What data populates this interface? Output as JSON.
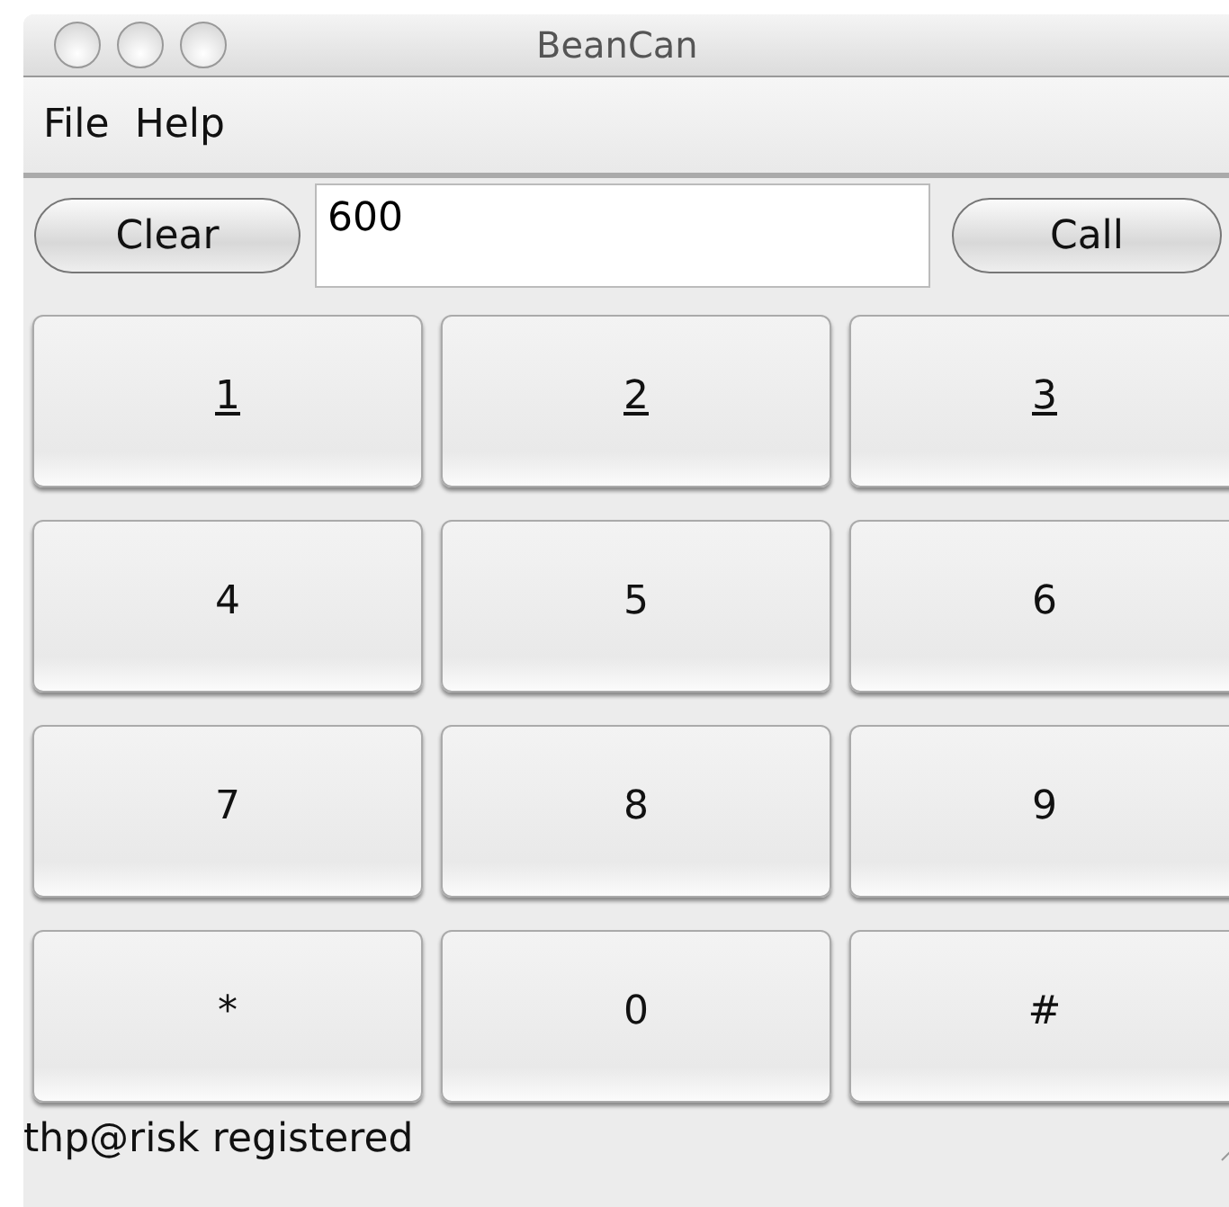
{
  "window": {
    "title": "BeanCan"
  },
  "menu": [
    "File",
    "Help"
  ],
  "toolbar": {
    "clear_button": "Clear",
    "number_field": "600",
    "call_button": "Call"
  },
  "keypad": [
    {
      "label": "1",
      "underlined": true
    },
    {
      "label": "2",
      "underlined": true
    },
    {
      "label": "3",
      "underlined": true
    },
    {
      "label": "4",
      "underlined": false
    },
    {
      "label": "5",
      "underlined": false
    },
    {
      "label": "6",
      "underlined": false
    },
    {
      "label": "7",
      "underlined": false
    },
    {
      "label": "8",
      "underlined": false
    },
    {
      "label": "9",
      "underlined": false
    },
    {
      "label": "*",
      "underlined": false
    },
    {
      "label": "0",
      "underlined": false
    },
    {
      "label": "#",
      "underlined": false
    }
  ],
  "status_bar": "thp@risk registered"
}
